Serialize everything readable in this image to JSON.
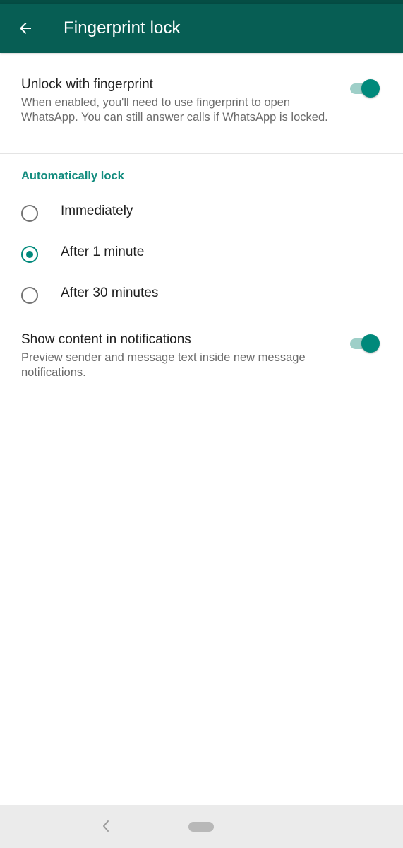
{
  "app_bar": {
    "title": "Fingerprint lock",
    "back_icon": "arrow-left-icon",
    "background": "#075e54"
  },
  "unlock_fingerprint": {
    "title": "Unlock with fingerprint",
    "description": "When enabled, you'll need to use fingerprint to open WhatsApp. You can still answer calls if WhatsApp is locked.",
    "enabled": true
  },
  "auto_lock": {
    "header": "Automatically lock",
    "options": [
      {
        "label": "Immediately",
        "selected": false
      },
      {
        "label": "After 1 minute",
        "selected": true
      },
      {
        "label": "After 30 minutes",
        "selected": false
      }
    ]
  },
  "notifications": {
    "title": "Show content in notifications",
    "description": "Preview sender and message text inside new message notifications.",
    "enabled": true
  },
  "nav_bar": {
    "back_icon": "chevron-left-icon",
    "home_icon": "home-pill-icon"
  },
  "colors": {
    "accent": "#00897b",
    "header_text": "#128c7e",
    "toggle_track": "#9ecfc8"
  }
}
